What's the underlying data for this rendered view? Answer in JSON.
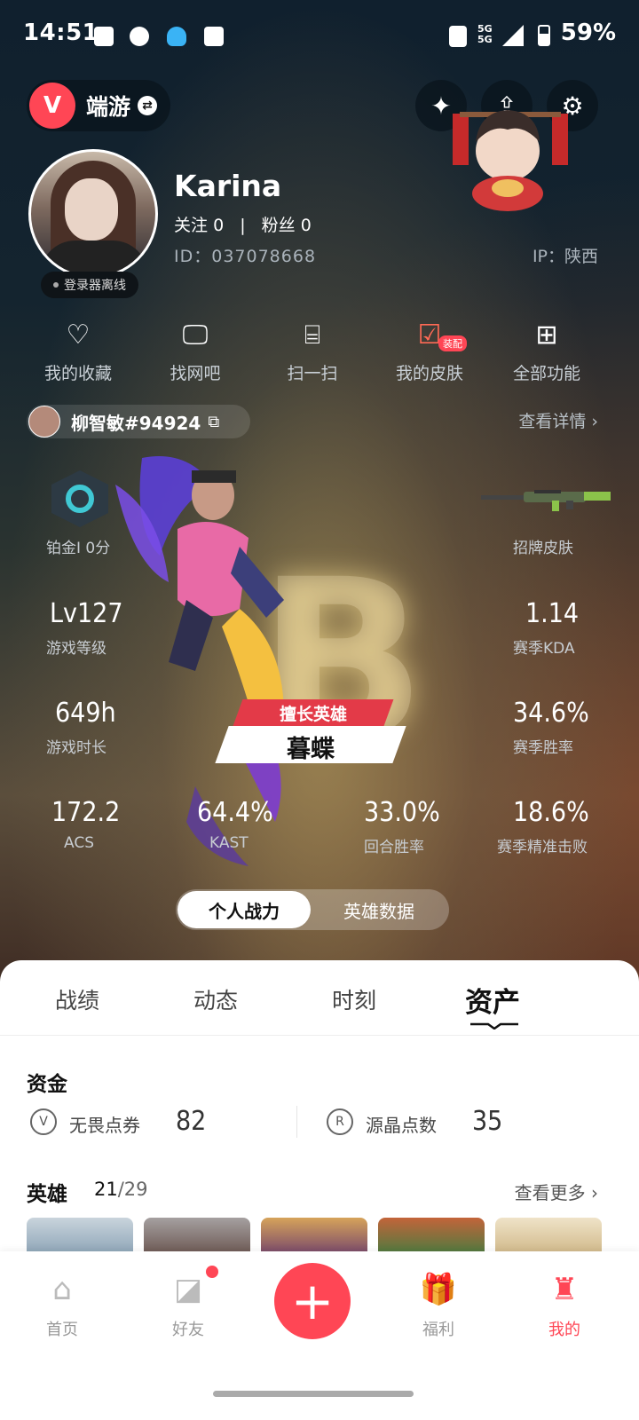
{
  "status_bar": {
    "time": "14:51",
    "battery": "59%",
    "network": "5G"
  },
  "top_bar": {
    "mode_label": "端游",
    "logo": "V"
  },
  "profile": {
    "name": "Karina",
    "follow_label": "关注",
    "follow_count": "0",
    "fans_label": "粉丝",
    "fans_count": "0",
    "id_text": "ID：037078668",
    "ip_text": "IP：陕西",
    "client_status": "登录器离线"
  },
  "quick_functions": [
    {
      "label": "我的收藏",
      "icon": "heart-icon"
    },
    {
      "label": "找网吧",
      "icon": "monitor-icon"
    },
    {
      "label": "扫一扫",
      "icon": "scan-icon"
    },
    {
      "label": "我的皮肤",
      "icon": "skin-icon",
      "badge": "装配"
    },
    {
      "label": "全部功能",
      "icon": "grid-icon"
    }
  ],
  "account": {
    "tag": "柳智敏#94924",
    "detail_link": "查看详情"
  },
  "rank": {
    "label": "铂金I 0分",
    "signature_skin_label": "招牌皮肤"
  },
  "stats": {
    "level": {
      "value": "Lv127",
      "label": "游戏等级"
    },
    "kda": {
      "value": "1.14",
      "label": "赛季KDA"
    },
    "playtime": {
      "value": "649h",
      "label": "游戏时长"
    },
    "winrate": {
      "value": "34.6%",
      "label": "赛季胜率"
    },
    "acs": {
      "value": "172.2",
      "label": "ACS"
    },
    "kast": {
      "value": "64.4%",
      "label": "KAST"
    },
    "round_winrate": {
      "value": "33.0%",
      "label": "回合胜率"
    },
    "headshot": {
      "value": "18.6%",
      "label": "赛季精准击败"
    }
  },
  "hero": {
    "tag": "擅长英雄",
    "name": "暮蝶",
    "rank_letter": "B"
  },
  "toggle": {
    "active": "个人战力",
    "inactive": "英雄数据"
  },
  "tabs": [
    "战绩",
    "动态",
    "时刻",
    "资产"
  ],
  "assets": {
    "funds_title": "资金",
    "currency1": {
      "label": "无畏点券",
      "value": "82"
    },
    "currency2": {
      "label": "源晶点数",
      "value": "35"
    },
    "heroes_title": "英雄",
    "heroes_owned": "21",
    "heroes_total": "/29",
    "more_link": "查看更多"
  },
  "bottom_nav": [
    {
      "label": "首页",
      "icon": "home-icon"
    },
    {
      "label": "好友",
      "icon": "friends-icon"
    },
    {
      "label": "福利",
      "icon": "gift-icon"
    },
    {
      "label": "我的",
      "icon": "profile-icon"
    }
  ],
  "colors": {
    "accent": "#ff4655",
    "rank_teal": "#40c8d4"
  }
}
